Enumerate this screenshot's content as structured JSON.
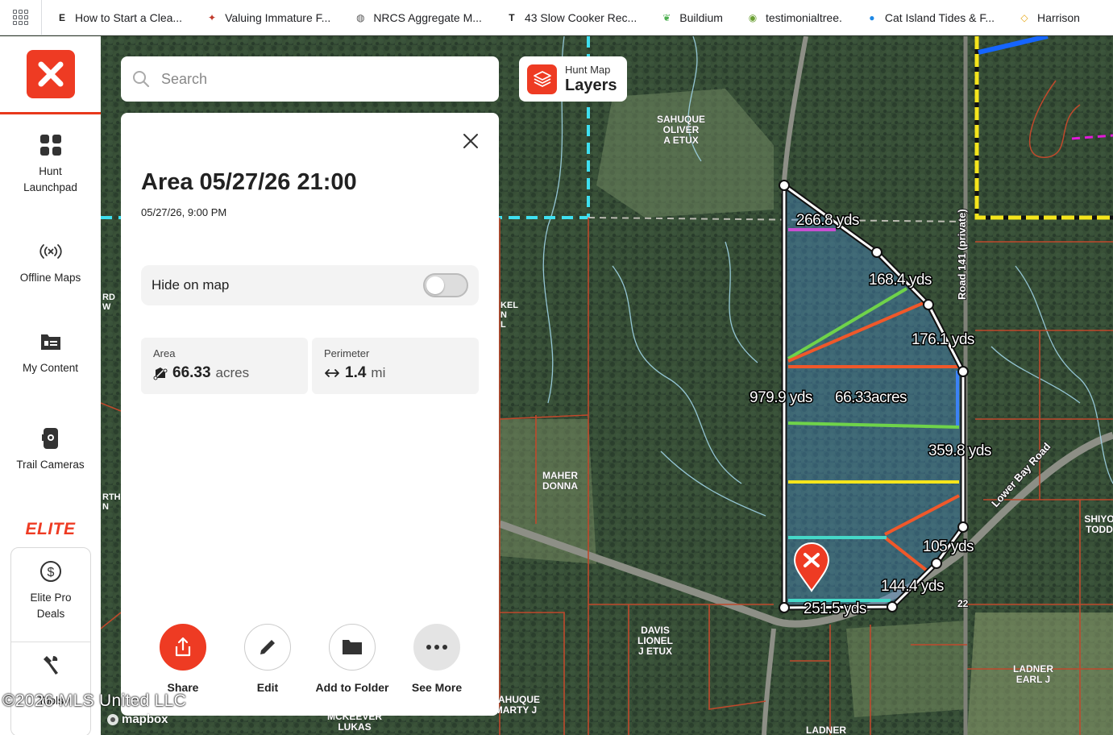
{
  "bookmarks": [
    {
      "label": "How to Start a Clea...",
      "icon": "etsy-icon",
      "color": "#222222",
      "glyph": "E"
    },
    {
      "label": "Valuing Immature F...",
      "icon": "deer-icon",
      "color": "#c0392b",
      "glyph": "✦"
    },
    {
      "label": "NRCS Aggregate M...",
      "icon": "globe-icon",
      "color": "#555555",
      "glyph": "◍"
    },
    {
      "label": "43 Slow Cooker Rec...",
      "icon": "tasty-icon",
      "color": "#222222",
      "glyph": "T"
    },
    {
      "label": "Buildium",
      "icon": "buildium-leaf-icon",
      "color": "#4caf50",
      "glyph": "❦"
    },
    {
      "label": "testimonialtree.",
      "icon": "testimonialtree-icon",
      "color": "#6a9f32",
      "glyph": "◉"
    },
    {
      "label": "Cat Island Tides & F...",
      "icon": "water-drop-icon",
      "color": "#1e88e5",
      "glyph": "●"
    },
    {
      "label": "Harrison",
      "icon": "harrison-icon",
      "color": "#e6a817",
      "glyph": "◇"
    }
  ],
  "sidebar": {
    "items": [
      {
        "label": "Hunt\nLaunchpad",
        "icon": "grid-icon"
      },
      {
        "label": "Offline Maps",
        "icon": "offline-signal-icon"
      },
      {
        "label": "My Content",
        "icon": "folder-card-icon"
      },
      {
        "label": "Trail Cameras",
        "icon": "trail-camera-icon"
      }
    ],
    "elite_label": "ELITE",
    "elite_items": [
      {
        "label": "Elite Pro\nDeals",
        "icon": "dollar-circle-icon"
      },
      {
        "label": "Tools",
        "icon": "tools-icon"
      }
    ]
  },
  "search": {
    "placeholder": "Search"
  },
  "layers": {
    "small": "Hunt Map",
    "big": "Layers"
  },
  "panel": {
    "title": "Area 05/27/26 21:00",
    "date": "05/27/26, 9:00 PM",
    "hide_label": "Hide on map",
    "hide_on": false,
    "area_label": "Area",
    "area_value": "66.33",
    "area_unit": "acres",
    "perimeter_label": "Perimeter",
    "perimeter_value": "1.4",
    "perimeter_unit": "mi",
    "actions": [
      {
        "label": "Share",
        "icon": "share-icon"
      },
      {
        "label": "Edit",
        "icon": "pencil-icon"
      },
      {
        "label": "Add to Folder",
        "icon": "folder-icon"
      },
      {
        "label": "See More",
        "icon": "more-dots-icon"
      }
    ]
  },
  "map": {
    "measurements": [
      "266.8 yds",
      "168.4 yds",
      "176.1 yds",
      "979.9 yds",
      "66.33acres",
      "359.8 yds",
      "105 yds",
      "144.4 yds",
      "251.5 yds"
    ],
    "owner_labels": [
      "SAHUQUE\nOLIVER\nA ETUX",
      "MAHER\nDONNA",
      "DAVIS\nLIONEL\nJ ETUX",
      "LADNER\nEARL J",
      "SHIYO\nTODD",
      "SAHUQUE\nMARTY J",
      "MCKEEVER\nLUKAS",
      "LADNER"
    ],
    "road_labels": [
      "Road 141 (private)",
      "Lower Bay Road",
      "22"
    ],
    "edge_fragments": [
      "RD\nW",
      "KEL\nN\nL",
      "RTH\nN"
    ]
  },
  "watermark": "©2026 MLS United LLC",
  "attribution": "mapbox",
  "colors": {
    "brand": "#ee3b23",
    "parcel_line": "#c0492c",
    "polygon_fill": "#4a90d9"
  }
}
